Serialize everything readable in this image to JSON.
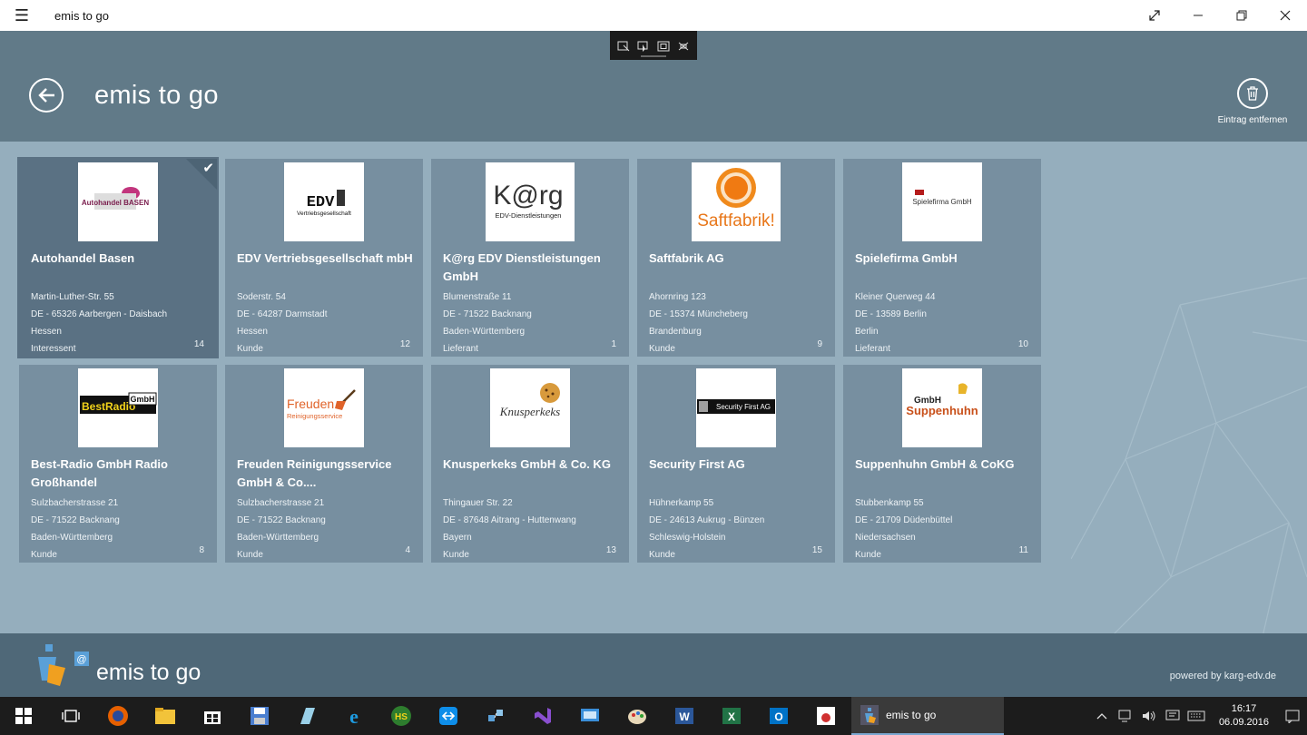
{
  "window": {
    "title": "emis to go"
  },
  "header": {
    "title": "emis to go",
    "delete_label": "Eintrag entfernen"
  },
  "entries": [
    {
      "name": "Autohandel Basen",
      "street": "Martin-Luther-Str. 55",
      "city": "DE - 65326 Aarbergen - Daisbach",
      "state": "Hessen",
      "type": "Interessent",
      "count": "14",
      "selected": true
    },
    {
      "name": "EDV Vertriebsgesellschaft mbH",
      "street": "Soderstr. 54",
      "city": "DE - 64287 Darmstadt",
      "state": "Hessen",
      "type": "Kunde",
      "count": "12"
    },
    {
      "name": "K@rg EDV Dienstleistungen GmbH",
      "street": "Blumenstraße 11",
      "city": "DE - 71522 Backnang",
      "state": "Baden-Württemberg",
      "type": "Lieferant",
      "count": "1"
    },
    {
      "name": "Saftfabrik AG",
      "street": "Ahornring 123",
      "city": "DE - 15374 Müncheberg",
      "state": "Brandenburg",
      "type": "Kunde",
      "count": "9"
    },
    {
      "name": "Spielefirma GmbH",
      "street": "Kleiner Querweg 44",
      "city": "DE - 13589 Berlin",
      "state": "Berlin",
      "type": "Lieferant",
      "count": "10"
    },
    {
      "name": "Best-Radio GmbH Radio Großhandel",
      "street": "Sulzbacherstrasse 21",
      "city": "DE - 71522 Backnang",
      "state": "Baden-Württemberg",
      "type": "Kunde",
      "count": "8"
    },
    {
      "name": "Freuden Reinigungsservice GmbH & Co....",
      "street": "Sulzbacherstrasse 21",
      "city": "DE - 71522 Backnang",
      "state": "Baden-Württemberg",
      "type": "Kunde",
      "count": "4"
    },
    {
      "name": "Knusperkeks GmbH & Co. KG",
      "street": "Thingauer Str. 22",
      "city": "DE - 87648 Aitrang - Huttenwang",
      "state": "Bayern",
      "type": "Kunde",
      "count": "13"
    },
    {
      "name": "Security First AG",
      "street": "Hühnerkamp 55",
      "city": "DE - 24613 Aukrug - Bünzen",
      "state": "Schleswig-Holstein",
      "type": "Kunde",
      "count": "15"
    },
    {
      "name": "Suppenhuhn GmbH & CoKG",
      "street": "Stubbenkamp 55",
      "city": "DE - 21709 Düdenbüttel",
      "state": "Niedersachsen",
      "type": "Kunde",
      "count": "11"
    }
  ],
  "logos": {
    "autohandel": "Autohandel BASEN",
    "edv_main": "EDV",
    "edv_sub": "Vertriebsgesellschaft",
    "karg_main": "K@rg",
    "karg_sub": "EDV-Dienstleistungen",
    "saft": "Saftfabrik!",
    "spiele": "Spielefirma GmbH",
    "bestradio": "BestRadio",
    "bestradio_gmbh": "GmbH",
    "freuden_main": "Freuden",
    "freuden_sub": "Reinigungsservice",
    "knusper": "Knusperkeks",
    "security": "Security First AG",
    "suppen_gmbh": "GmbH",
    "suppen_main": "Suppenhuhn"
  },
  "footer": {
    "brand": "emis to go",
    "powered": "powered by karg-edv.de"
  },
  "taskbar": {
    "active_app": "emis to go",
    "time": "16:17",
    "date": "06.09.2016"
  },
  "colors": {
    "header": "#617a88",
    "content": "#95aebd",
    "tile": "#778fa0",
    "tile_selected": "#5a7183",
    "footer": "#4f6878"
  }
}
